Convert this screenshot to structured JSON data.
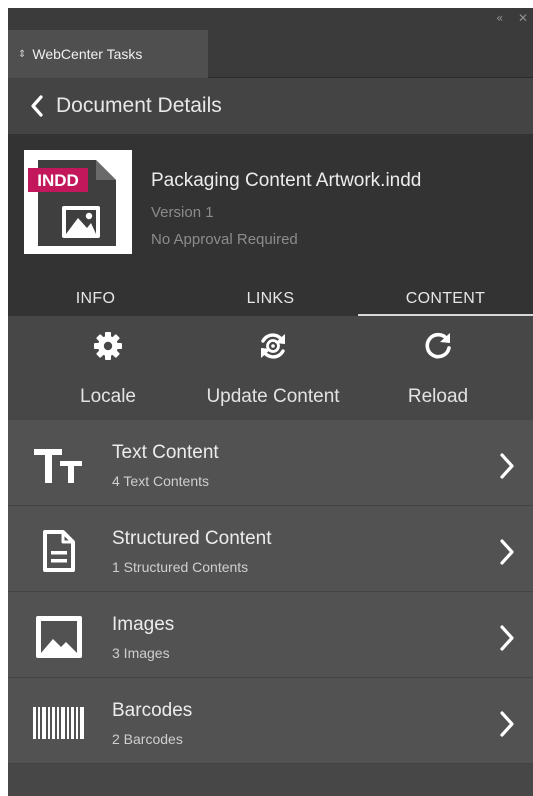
{
  "window": {
    "collapse_glyph": "«",
    "close_glyph": "✕"
  },
  "panel_tab": {
    "label": "WebCenter Tasks"
  },
  "nav": {
    "title": "Document Details",
    "back_icon": "chevron-left-icon"
  },
  "document": {
    "badge": "INDD",
    "name": "Packaging Content Artwork.indd",
    "version": "Version 1",
    "approval": "No Approval Required",
    "badge_color": "#c2185b"
  },
  "tabs": [
    {
      "label": "INFO",
      "active": false
    },
    {
      "label": "LINKS",
      "active": false
    },
    {
      "label": "CONTENT",
      "active": true
    }
  ],
  "actions": [
    {
      "label": "Locale",
      "icon": "gear-icon"
    },
    {
      "label": "Update Content",
      "icon": "sync-icon"
    },
    {
      "label": "Reload",
      "icon": "reload-icon"
    }
  ],
  "content_items": [
    {
      "title": "Text Content",
      "subtitle": "4 Text Contents",
      "icon": "text-icon"
    },
    {
      "title": "Structured Content",
      "subtitle": "1 Structured Contents",
      "icon": "document-icon"
    },
    {
      "title": "Images",
      "subtitle": "3 Images",
      "icon": "image-icon"
    },
    {
      "title": "Barcodes",
      "subtitle": "2 Barcodes",
      "icon": "barcode-icon"
    }
  ]
}
